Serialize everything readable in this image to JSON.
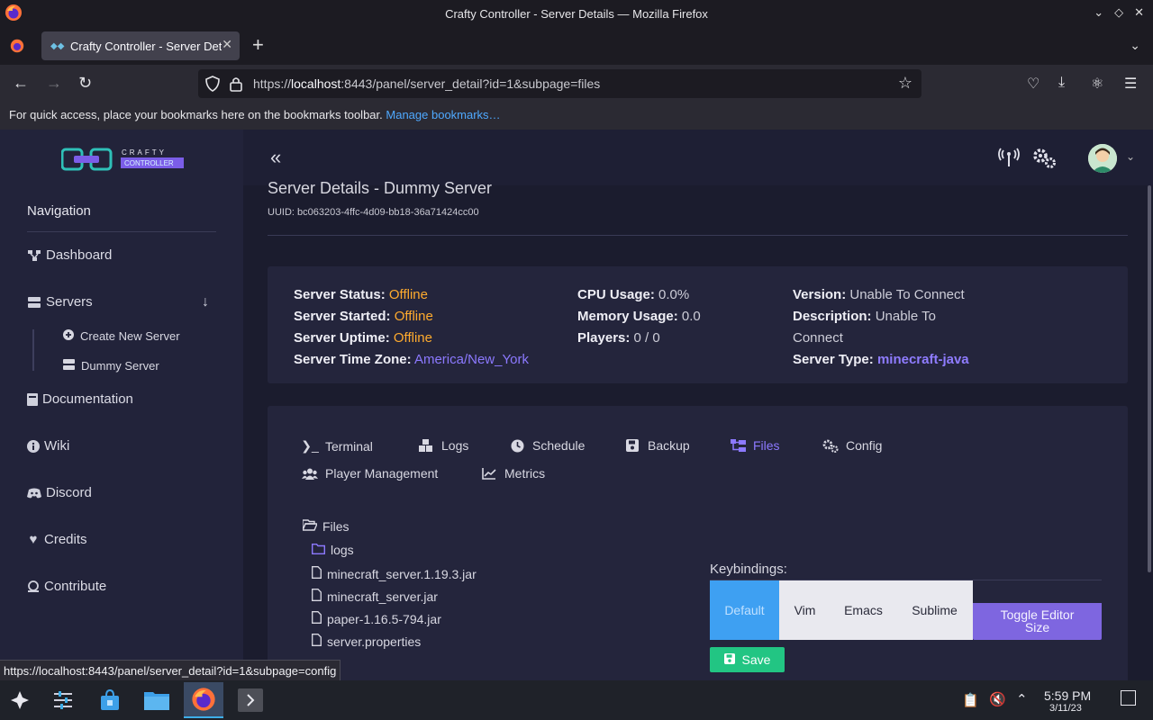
{
  "window": {
    "title": "Crafty Controller - Server Details — Mozilla Firefox"
  },
  "browser": {
    "tab_title": "Crafty Controller - Server Details",
    "url_prefix": "https://",
    "url_host": "localhost",
    "url_rest": ":8443/panel/server_detail?id=1&subpage=files",
    "bookmarks_text": "For quick access, place your bookmarks here on the bookmarks toolbar.",
    "manage_bookmarks": "Manage bookmarks…",
    "status_url": "https://localhost:8443/panel/server_detail?id=1&subpage=config"
  },
  "sidebar": {
    "brand_top": "CRAFTY",
    "brand_bottom": "CONTROLLER",
    "heading": "Navigation",
    "items": {
      "dashboard": "Dashboard",
      "servers": "Servers",
      "create_server": "Create New Server",
      "dummy_server": "Dummy Server",
      "documentation": "Documentation",
      "wiki": "Wiki",
      "discord": "Discord",
      "credits": "Credits",
      "contribute": "Contribute"
    }
  },
  "page": {
    "title": "Server Details - Dummy Server",
    "uuid": "UUID: bc063203-4ffc-4d09-bb18-36a71424cc00"
  },
  "status": {
    "server_status_label": "Server Status:",
    "server_status": "Offline",
    "server_started_label": "Server Started:",
    "server_started": "Offline",
    "server_uptime_label": "Server Uptime:",
    "server_uptime": "Offline",
    "time_zone_label": "Server Time Zone:",
    "time_zone": "America/New_York",
    "cpu_label": "CPU Usage:",
    "cpu": "0.0%",
    "memory_label": "Memory Usage:",
    "memory": "0.0",
    "players_label": "Players:",
    "players": "0 / 0",
    "version_label": "Version:",
    "version": "Unable To Connect",
    "description_label": "Description:",
    "description_1": "Unable To",
    "description_2": "Connect",
    "server_type_label": "Server Type:",
    "server_type": "minecraft-java"
  },
  "tabs": {
    "terminal": "Terminal",
    "logs": "Logs",
    "schedule": "Schedule",
    "backup": "Backup",
    "files": "Files",
    "config": "Config",
    "player_management": "Player Management",
    "metrics": "Metrics"
  },
  "file_tree": {
    "root": "Files",
    "items": [
      "logs",
      "minecraft_server.1.19.3.jar",
      "minecraft_server.jar",
      "paper-1.16.5-794.jar",
      "server.properties"
    ]
  },
  "editor": {
    "keybindings_label": "Keybindings:",
    "keybindings": [
      "Default",
      "Vim",
      "Emacs",
      "Sublime"
    ],
    "selected_keybinding": "Default",
    "toggle_size_1": "Toggle Editor",
    "toggle_size_2": "Size",
    "save": "Save"
  },
  "taskbar": {
    "time": "5:59 PM",
    "date": "3/11/23"
  },
  "colors": {
    "offline": "#ffab2e",
    "link_violet": "#8c79ff",
    "active_keybinding": "#3ea0f2",
    "save_green": "#22c583",
    "toggle_purple": "#7e66e0"
  }
}
